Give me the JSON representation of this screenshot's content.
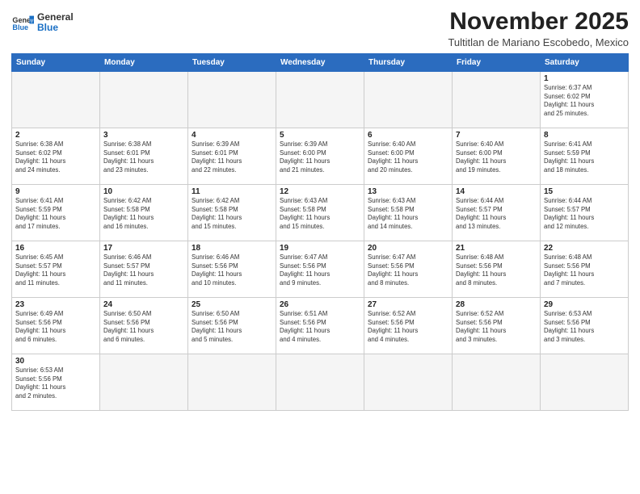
{
  "header": {
    "logo_general": "General",
    "logo_blue": "Blue",
    "month": "November 2025",
    "subtitle": "Tultitlan de Mariano Escobedo, Mexico"
  },
  "weekdays": [
    "Sunday",
    "Monday",
    "Tuesday",
    "Wednesday",
    "Thursday",
    "Friday",
    "Saturday"
  ],
  "weeks": [
    [
      {
        "day": "",
        "info": ""
      },
      {
        "day": "",
        "info": ""
      },
      {
        "day": "",
        "info": ""
      },
      {
        "day": "",
        "info": ""
      },
      {
        "day": "",
        "info": ""
      },
      {
        "day": "",
        "info": ""
      },
      {
        "day": "1",
        "info": "Sunrise: 6:37 AM\nSunset: 6:02 PM\nDaylight: 11 hours\nand 25 minutes."
      }
    ],
    [
      {
        "day": "2",
        "info": "Sunrise: 6:38 AM\nSunset: 6:02 PM\nDaylight: 11 hours\nand 24 minutes."
      },
      {
        "day": "3",
        "info": "Sunrise: 6:38 AM\nSunset: 6:01 PM\nDaylight: 11 hours\nand 23 minutes."
      },
      {
        "day": "4",
        "info": "Sunrise: 6:39 AM\nSunset: 6:01 PM\nDaylight: 11 hours\nand 22 minutes."
      },
      {
        "day": "5",
        "info": "Sunrise: 6:39 AM\nSunset: 6:00 PM\nDaylight: 11 hours\nand 21 minutes."
      },
      {
        "day": "6",
        "info": "Sunrise: 6:40 AM\nSunset: 6:00 PM\nDaylight: 11 hours\nand 20 minutes."
      },
      {
        "day": "7",
        "info": "Sunrise: 6:40 AM\nSunset: 6:00 PM\nDaylight: 11 hours\nand 19 minutes."
      },
      {
        "day": "8",
        "info": "Sunrise: 6:41 AM\nSunset: 5:59 PM\nDaylight: 11 hours\nand 18 minutes."
      }
    ],
    [
      {
        "day": "9",
        "info": "Sunrise: 6:41 AM\nSunset: 5:59 PM\nDaylight: 11 hours\nand 17 minutes."
      },
      {
        "day": "10",
        "info": "Sunrise: 6:42 AM\nSunset: 5:58 PM\nDaylight: 11 hours\nand 16 minutes."
      },
      {
        "day": "11",
        "info": "Sunrise: 6:42 AM\nSunset: 5:58 PM\nDaylight: 11 hours\nand 15 minutes."
      },
      {
        "day": "12",
        "info": "Sunrise: 6:43 AM\nSunset: 5:58 PM\nDaylight: 11 hours\nand 15 minutes."
      },
      {
        "day": "13",
        "info": "Sunrise: 6:43 AM\nSunset: 5:58 PM\nDaylight: 11 hours\nand 14 minutes."
      },
      {
        "day": "14",
        "info": "Sunrise: 6:44 AM\nSunset: 5:57 PM\nDaylight: 11 hours\nand 13 minutes."
      },
      {
        "day": "15",
        "info": "Sunrise: 6:44 AM\nSunset: 5:57 PM\nDaylight: 11 hours\nand 12 minutes."
      }
    ],
    [
      {
        "day": "16",
        "info": "Sunrise: 6:45 AM\nSunset: 5:57 PM\nDaylight: 11 hours\nand 11 minutes."
      },
      {
        "day": "17",
        "info": "Sunrise: 6:46 AM\nSunset: 5:57 PM\nDaylight: 11 hours\nand 11 minutes."
      },
      {
        "day": "18",
        "info": "Sunrise: 6:46 AM\nSunset: 5:56 PM\nDaylight: 11 hours\nand 10 minutes."
      },
      {
        "day": "19",
        "info": "Sunrise: 6:47 AM\nSunset: 5:56 PM\nDaylight: 11 hours\nand 9 minutes."
      },
      {
        "day": "20",
        "info": "Sunrise: 6:47 AM\nSunset: 5:56 PM\nDaylight: 11 hours\nand 8 minutes."
      },
      {
        "day": "21",
        "info": "Sunrise: 6:48 AM\nSunset: 5:56 PM\nDaylight: 11 hours\nand 8 minutes."
      },
      {
        "day": "22",
        "info": "Sunrise: 6:48 AM\nSunset: 5:56 PM\nDaylight: 11 hours\nand 7 minutes."
      }
    ],
    [
      {
        "day": "23",
        "info": "Sunrise: 6:49 AM\nSunset: 5:56 PM\nDaylight: 11 hours\nand 6 minutes."
      },
      {
        "day": "24",
        "info": "Sunrise: 6:50 AM\nSunset: 5:56 PM\nDaylight: 11 hours\nand 6 minutes."
      },
      {
        "day": "25",
        "info": "Sunrise: 6:50 AM\nSunset: 5:56 PM\nDaylight: 11 hours\nand 5 minutes."
      },
      {
        "day": "26",
        "info": "Sunrise: 6:51 AM\nSunset: 5:56 PM\nDaylight: 11 hours\nand 4 minutes."
      },
      {
        "day": "27",
        "info": "Sunrise: 6:52 AM\nSunset: 5:56 PM\nDaylight: 11 hours\nand 4 minutes."
      },
      {
        "day": "28",
        "info": "Sunrise: 6:52 AM\nSunset: 5:56 PM\nDaylight: 11 hours\nand 3 minutes."
      },
      {
        "day": "29",
        "info": "Sunrise: 6:53 AM\nSunset: 5:56 PM\nDaylight: 11 hours\nand 3 minutes."
      }
    ],
    [
      {
        "day": "30",
        "info": "Sunrise: 6:53 AM\nSunset: 5:56 PM\nDaylight: 11 hours\nand 2 minutes."
      },
      {
        "day": "",
        "info": ""
      },
      {
        "day": "",
        "info": ""
      },
      {
        "day": "",
        "info": ""
      },
      {
        "day": "",
        "info": ""
      },
      {
        "day": "",
        "info": ""
      },
      {
        "day": "",
        "info": ""
      }
    ]
  ]
}
